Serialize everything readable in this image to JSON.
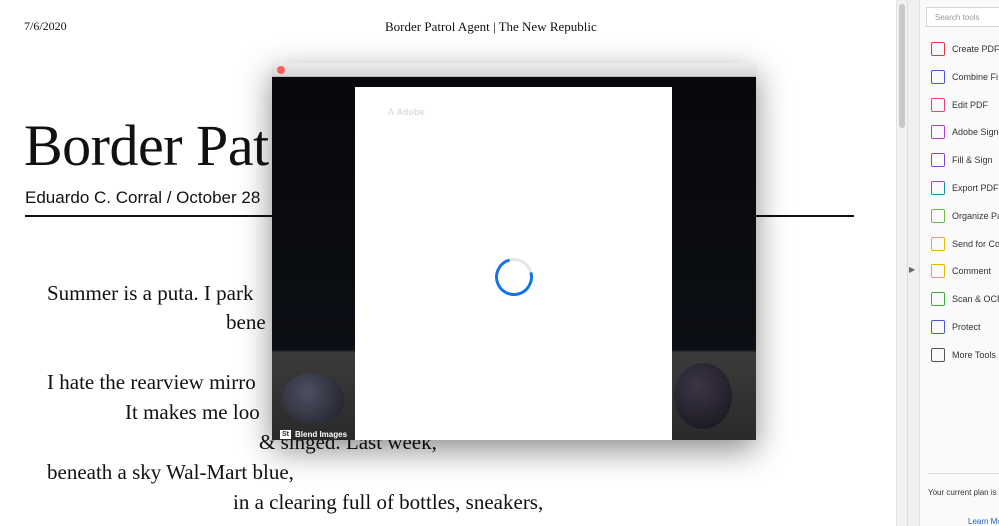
{
  "page": {
    "date": "7/6/2020",
    "title": "Border Patrol Agent | The New Republic",
    "headline": "Border Pat",
    "byline": "Eduardo C. Corral  / October 28",
    "poem": [
      "Summer is a puta. I park",
      "bene",
      "I hate the rearview mirro",
      "It makes me loo",
      "& singed. Last week,",
      "beneath a sky Wal-Mart blue,",
      "in a clearing full of bottles, sneakers,"
    ]
  },
  "modal": {
    "brand": "Adobe",
    "stock_badge": "St",
    "stock_credit": "Blend Images",
    "spinner_color": "#1473e6"
  },
  "tools": {
    "search_placeholder": "Search tools",
    "items": [
      {
        "label": "Create PDF",
        "icon": "create-pdf-icon",
        "color": "#e0383e"
      },
      {
        "label": "Combine Fi",
        "icon": "combine-files-icon",
        "color": "#4b56d6"
      },
      {
        "label": "Edit PDF",
        "icon": "edit-pdf-icon",
        "color": "#e8407a"
      },
      {
        "label": "Adobe Sign",
        "icon": "adobe-sign-icon",
        "color": "#b43ec8"
      },
      {
        "label": "Fill & Sign",
        "icon": "fill-sign-icon",
        "color": "#7a46d6"
      },
      {
        "label": "Export PDF",
        "icon": "export-pdf-icon",
        "color": "#1b8ca8"
      },
      {
        "label": "Organize Pa",
        "icon": "organize-pages-icon",
        "color": "#6cbe45"
      },
      {
        "label": "Send for Co",
        "icon": "send-for-comments-icon",
        "color": "#e5b800"
      },
      {
        "label": "Comment",
        "icon": "comment-icon",
        "color": "#e0b400"
      },
      {
        "label": "Scan & OCR",
        "icon": "scan-ocr-icon",
        "color": "#3daa3d"
      },
      {
        "label": "Protect",
        "icon": "protect-icon",
        "color": "#4b56d6"
      },
      {
        "label": "More Tools",
        "icon": "more-tools-icon",
        "color": "#555555"
      }
    ],
    "plan_text": "Your current plan is C",
    "learn_more": "Learn Mo"
  }
}
